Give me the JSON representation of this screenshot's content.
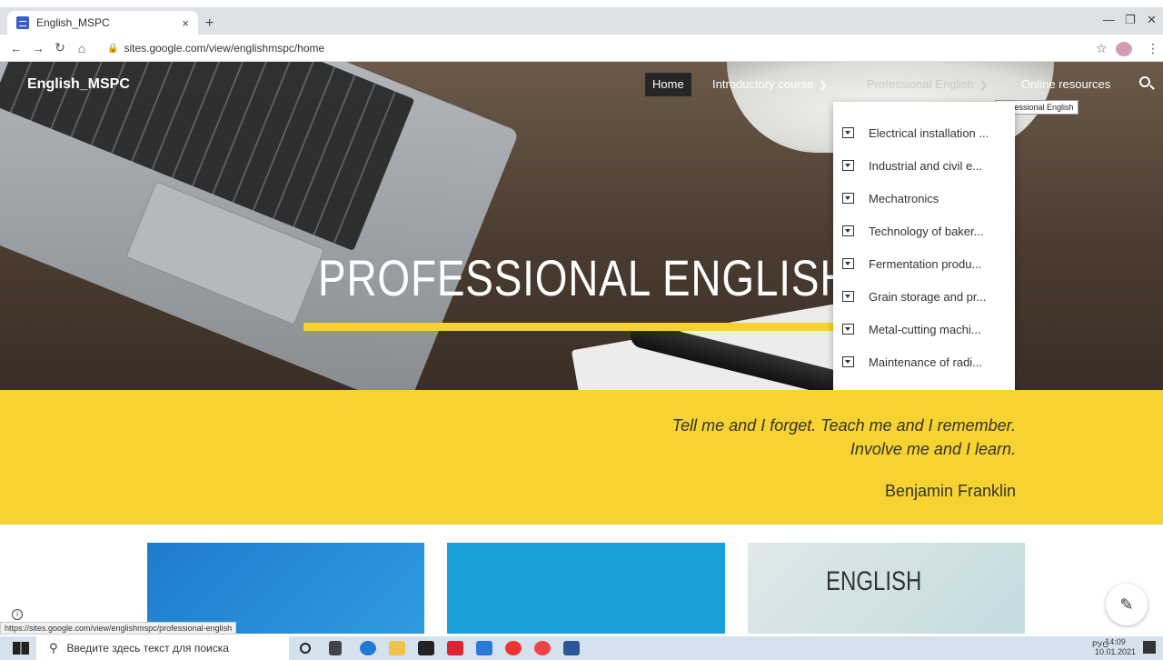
{
  "browser": {
    "tab_title": "English_MSPC",
    "tab_close": "×",
    "new_tab": "+",
    "url": "sites.google.com/view/englishmspc/home",
    "status_url": "https://sites.google.com/view/englishmspc/professional-english"
  },
  "site": {
    "title": "English_MSPC",
    "nav": [
      {
        "label": "Home"
      },
      {
        "label": "Introductory course"
      },
      {
        "label": "Professional English"
      },
      {
        "label": "Online resources"
      }
    ],
    "tooltip": "Professional English",
    "hero_title": "PROFESSIONAL ENGLISH",
    "dropdown": [
      "Electrical installation ...",
      "Industrial and civil e...",
      "Mechatronics",
      "Technology of baker...",
      "Fermentation produ...",
      "Grain storage and pr...",
      "Metal-cutting machi...",
      "Maintenance of radi..."
    ],
    "quote_line1": "Tell me and I forget. Teach me and I remember.",
    "quote_line2": "Involve me and I learn.",
    "quote_author": "Benjamin Franklin",
    "card3_text": "ENGLISH"
  },
  "taskbar": {
    "search_placeholder": "Введите здесь текст для поиска",
    "lang": "РУС",
    "time": "14:09",
    "date": "10.01.2021"
  },
  "colors": {
    "accent_yellow": "#f6d330",
    "active_nav": "#262626"
  }
}
